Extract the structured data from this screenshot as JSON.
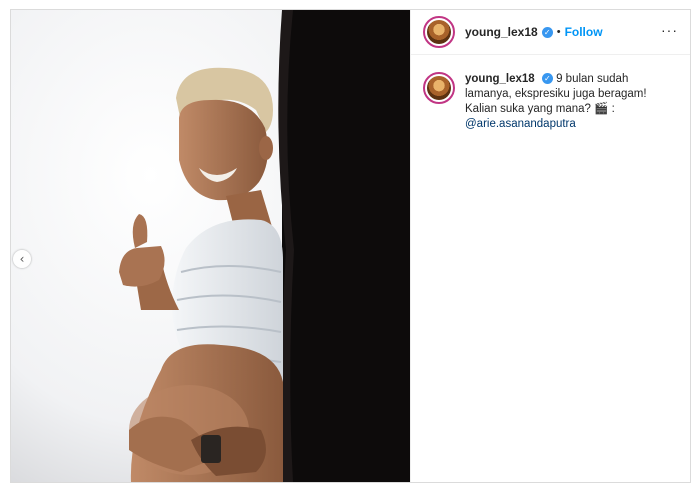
{
  "post": {
    "username": "young_lex18",
    "verified_icon": "verified-badge-icon",
    "separator": "•",
    "follow_label": "Follow",
    "more_label": "···",
    "caption": {
      "username": "young_lex18",
      "text": "9 bulan sudah lamanya, ekspresiku juga beragam! Kalian suka yang mana? 🎬 :",
      "mention": "@arie.asanandaputra"
    },
    "prev_label": "‹"
  },
  "colors": {
    "accent": "#0095f6",
    "verified": "#3897f0",
    "text": "#262626",
    "border": "#dbdbdb"
  }
}
